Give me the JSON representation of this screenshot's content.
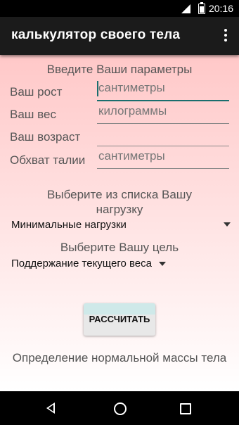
{
  "status": {
    "time": "20:16"
  },
  "appbar": {
    "title": "калькулятор своего тела"
  },
  "form": {
    "heading": "Введите Ваши параметры",
    "fields": [
      {
        "label": "Ваш рост",
        "placeholder": "сантиметры"
      },
      {
        "label": "Ваш вес",
        "placeholder": "килограммы"
      },
      {
        "label": "Ваш возраст",
        "placeholder": ""
      },
      {
        "label": "Обхват талии",
        "placeholder": "сантиметры"
      }
    ]
  },
  "load": {
    "prompt": "Выберите из списка Вашу нагрузку",
    "selected": "Минимальные нагрузки"
  },
  "goal": {
    "prompt": "Выберите Вашу цель",
    "selected": "Поддержание текущего веса"
  },
  "calculate_label": "РАССЧИТАТЬ",
  "result_note": "Определение нормальной массы тела",
  "colors": {
    "appbar": "#1b1b1b",
    "accent": "#1a6e6e",
    "gradient_top": "#ffc8c8"
  }
}
